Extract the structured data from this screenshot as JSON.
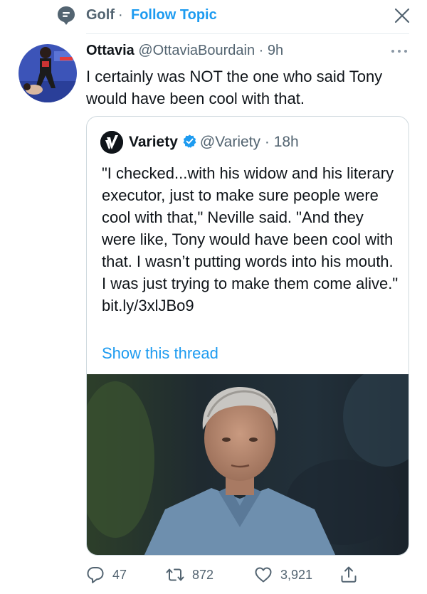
{
  "topic": {
    "name": "Golf",
    "separator": "·",
    "follow_label": "Follow Topic",
    "icon": "topic-icon"
  },
  "tweet": {
    "author_name": "Ottavia",
    "handle": "@OttaviaBourdain",
    "separator": "·",
    "time": "9h",
    "text": "I certainly was NOT the one who said Tony would have been cool with that."
  },
  "quote": {
    "author_name": "Variety",
    "handle": "@Variety",
    "separator": "·",
    "time": "18h",
    "text": "\"I checked...with his widow and his literary executor, just to make sure people were cool with that,\" Neville said. \"And they were like, Tony would have been cool with that. I wasn’t putting words into his mouth. I was just trying to make them come alive.\" bit.ly/3xlJBo9",
    "show_thread_label": "Show this thread"
  },
  "actions": {
    "replies": "47",
    "retweets": "872",
    "likes": "3,921"
  },
  "colors": {
    "accent": "#1d9bf0",
    "secondary_text": "#536471",
    "border": "#cfd9de"
  }
}
